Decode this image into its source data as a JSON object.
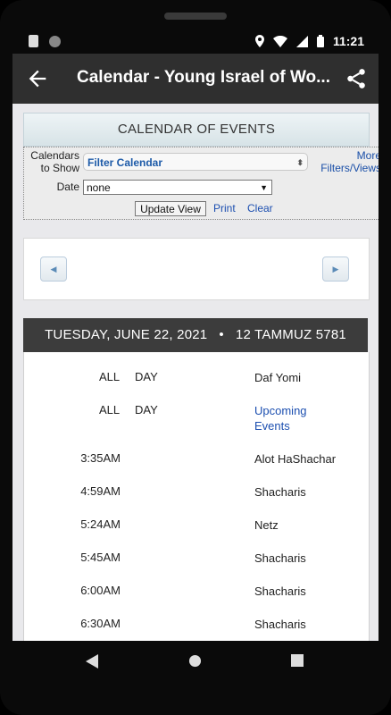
{
  "status_bar": {
    "time": "11:21",
    "icons": [
      "sd-card-icon",
      "circle-icon",
      "location-icon",
      "wifi-icon",
      "signal-icon",
      "battery-icon"
    ]
  },
  "app_bar": {
    "title": "Calendar - Young Israel of Wo...",
    "back_icon": "arrow-left-icon",
    "share_icon": "share-icon"
  },
  "calendar": {
    "header": "CALENDAR OF EVENTS",
    "filter": {
      "calendars_label_1": "Calendars",
      "calendars_label_2": "to Show",
      "filter_value": "Filter Calendar",
      "more_line_1": "More",
      "more_line_2": "Filters/Views",
      "date_label": "Date",
      "date_value": "none",
      "update_button": "Update View",
      "print_link": "Print",
      "clear_link": "Clear"
    },
    "day_header": "TUESDAY, JUNE 22, 2021   •   12 TAMMUZ 5781",
    "events": [
      {
        "time_a": "ALL",
        "time_b": "DAY",
        "name": "Daf Yomi",
        "is_link": false
      },
      {
        "time_a": "ALL",
        "time_b": "DAY",
        "name": "Upcoming Events",
        "is_link": true
      },
      {
        "time": "3:35AM",
        "name": "Alot HaShachar",
        "is_link": false
      },
      {
        "time": "4:59AM",
        "name": "Shacharis",
        "is_link": false
      },
      {
        "time": "5:24AM",
        "name": "Netz",
        "is_link": false
      },
      {
        "time": "5:45AM",
        "name": "Shacharis",
        "is_link": false
      },
      {
        "time": "6:00AM",
        "name": "Shacharis",
        "is_link": false
      },
      {
        "time": "6:30AM",
        "name": "Shacharis",
        "is_link": false
      }
    ]
  },
  "colors": {
    "app_bar": "#2f2f2f",
    "link": "#1c4fb0",
    "day_header": "#3c3c3c"
  }
}
